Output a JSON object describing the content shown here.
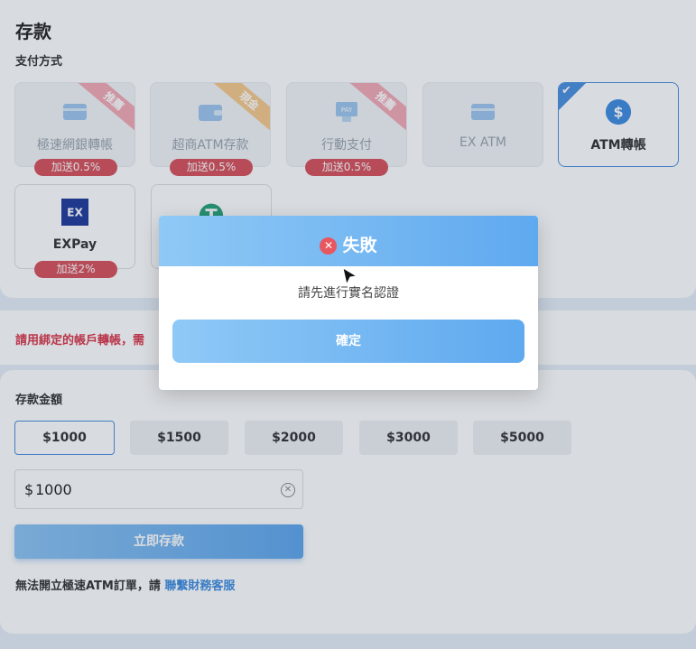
{
  "page": {
    "title": "存款",
    "payment_method_label": "支付方式"
  },
  "payment_methods": [
    {
      "label": "極速網銀轉帳",
      "ribbon": "推薦",
      "bonus": "加送0.5%"
    },
    {
      "label": "超商ATM存款",
      "ribbon": "現金",
      "bonus": "加送0.5%"
    },
    {
      "label": "行動支付",
      "ribbon": "推薦",
      "bonus": "加送0.5%"
    },
    {
      "label": "EX ATM"
    },
    {
      "label": "ATM轉帳"
    },
    {
      "label": "EXPay",
      "bonus": "加送2%"
    }
  ],
  "notice": "請用綁定的帳戶轉帳，需",
  "deposit": {
    "amount_label": "存款金額",
    "presets": [
      "$1000",
      "$1500",
      "$2000",
      "$3000",
      "$5000"
    ],
    "currency": "$",
    "input_value": "1000",
    "submit_label": "立即存款",
    "footer_text": "無法開立極速ATM訂單，請",
    "footer_link": "聯繫財務客服"
  },
  "modal": {
    "title": "失敗",
    "message": "請先進行實名認證",
    "confirm_label": "確定"
  },
  "colors": {
    "accent": "#4a8fe0",
    "danger": "#d7505a",
    "ribbon_pink": "#f3a9b5",
    "ribbon_orange": "#f6c98a"
  }
}
